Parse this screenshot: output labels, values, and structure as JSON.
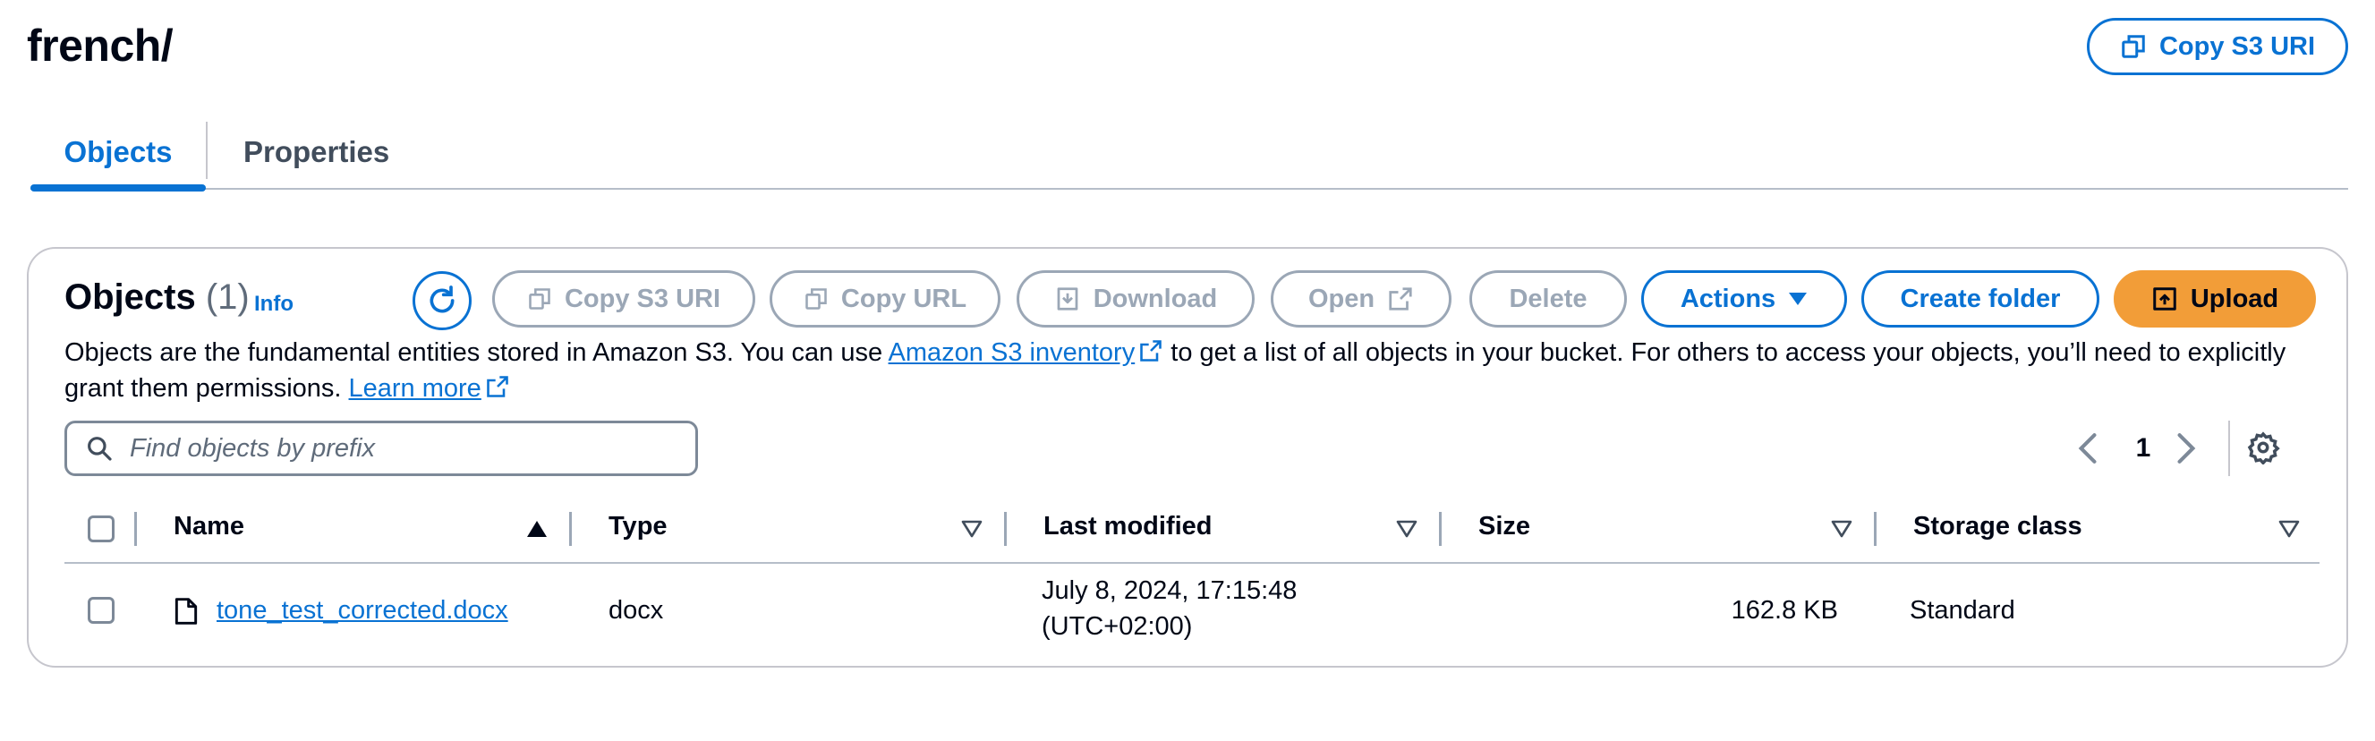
{
  "header": {
    "title": "french/",
    "copy_s3_uri_label": "Copy S3 URI"
  },
  "tabs": [
    {
      "label": "Objects",
      "active": true
    },
    {
      "label": "Properties",
      "active": false
    }
  ],
  "objects_panel": {
    "heading": "Objects",
    "count": "(1)",
    "info_label": "Info",
    "toolbar": {
      "copy_s3_uri": "Copy S3 URI",
      "copy_url": "Copy URL",
      "download": "Download",
      "open": "Open",
      "delete": "Delete",
      "actions": "Actions",
      "create_folder": "Create folder",
      "upload": "Upload"
    },
    "description": {
      "part1": "Objects are the fundamental entities stored in Amazon S3. You can use ",
      "inventory_link": "Amazon S3 inventory",
      "part2": " to get a list of all objects in your bucket. For others to access your objects, you’ll need to explicitly grant them permissions. ",
      "learn_more": "Learn more"
    },
    "search": {
      "placeholder": "Find objects by prefix",
      "value": ""
    },
    "pagination": {
      "current_page": "1"
    },
    "table": {
      "columns": [
        "Name",
        "Type",
        "Last modified",
        "Size",
        "Storage class"
      ],
      "rows": [
        {
          "name": "tone_test_corrected.docx",
          "type": "docx",
          "last_modified_date": "July 8, 2024, 17:15:48",
          "last_modified_tz": "(UTC+02:00)",
          "size": "162.8 KB",
          "storage_class": "Standard"
        }
      ]
    }
  },
  "colors": {
    "accent": "#0972d3",
    "upload": "#f29d38",
    "disabled": "#9ba7b6",
    "text": "#000716"
  },
  "icons": [
    "copy-icon",
    "refresh-icon",
    "download-icon",
    "external-link-icon",
    "caret-down-icon",
    "upload-icon",
    "search-icon",
    "chevron-left-icon",
    "chevron-right-icon",
    "settings-icon",
    "sort-ascending-icon",
    "sort-icon",
    "file-icon"
  ]
}
